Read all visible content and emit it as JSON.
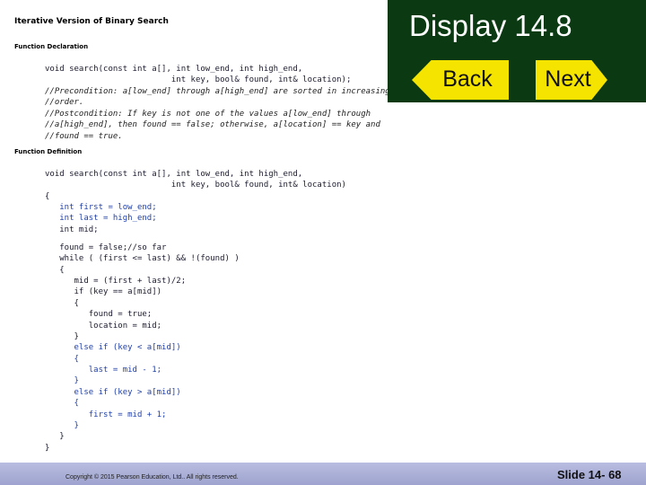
{
  "slide": {
    "code_title": "Iterative Version of Binary Search",
    "declaration_heading": "Function Declaration",
    "declaration_lines": [
      "void search(const int a[], int low_end, int high_end,",
      "                          int key, bool& found, int& location);",
      "//Precondition: a[low_end] through a[high_end] are sorted in increasing",
      "//order.",
      "//Postcondition: If key is not one of the values a[low_end] through",
      "//a[high_end], then found == false; otherwise, a[location] == key and",
      "//found == true."
    ],
    "definition_heading": "Function Definition",
    "definition_lines": [
      "void search(const int a[], int low_end, int high_end,",
      "                          int key, bool& found, int& location)",
      "{",
      "   int first = low_end;",
      "   int last = high_end;",
      "   int mid;",
      "",
      "   found = false;//so far",
      "   while ( (first <= last) && !(found) )",
      "   {",
      "      mid = (first + last)/2;",
      "      if (key == a[mid])",
      "      {",
      "         found = true;",
      "         location = mid;",
      "      }",
      "      else if (key < a[mid])",
      "      {",
      "         last = mid - 1;",
      "      }",
      "      else if (key > a[mid])",
      "      {",
      "         first = mid + 1;",
      "      }",
      "   }",
      "}"
    ]
  },
  "nav": {
    "display_title": "Display 14.8",
    "back_label": "Back",
    "next_label": "Next"
  },
  "footer": {
    "copyright": "Copyright © 2015 Pearson Education, Ltd.. All rights reserved.",
    "slide_number": "Slide 14- 68"
  }
}
